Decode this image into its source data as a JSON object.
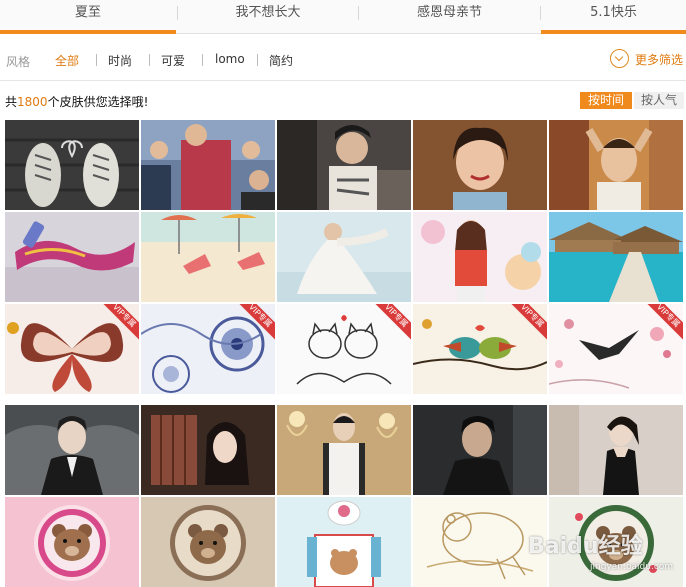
{
  "tabs": [
    {
      "label": "夏至",
      "active": true
    },
    {
      "label": "我不想长大",
      "active": false
    },
    {
      "label": "感恩母亲节",
      "active": false
    },
    {
      "label": "5.1快乐",
      "active": true
    }
  ],
  "filters": {
    "label": "风格",
    "items": [
      {
        "label": "全部",
        "active": true
      },
      {
        "label": "时尚",
        "active": false
      },
      {
        "label": "可爱",
        "active": false
      },
      {
        "label": "lomo",
        "active": false
      },
      {
        "label": "简约",
        "active": false
      }
    ],
    "more_label": "更多筛选"
  },
  "summary": {
    "prefix": "共",
    "count": "1800",
    "suffix": "个皮肤供您选择哦!"
  },
  "sort": {
    "by_time": "按时间",
    "by_popularity": "按人气"
  },
  "vip_badge": "VIP专属",
  "watermark": {
    "brand": "Baidu经验",
    "url": "jingyan.baidu.com"
  },
  "colors": {
    "accent": "#f08a1d",
    "accent_text": "#e07a10",
    "vip": "#d93a3a"
  },
  "tiles": [
    {
      "name": "sneakers-heart",
      "vip": false
    },
    {
      "name": "men-red-room",
      "vip": false
    },
    {
      "name": "young-man-graphic",
      "vip": false
    },
    {
      "name": "woman-smiling",
      "vip": false
    },
    {
      "name": "man-hands-on-head",
      "vip": false
    },
    {
      "name": "beach-scarf",
      "vip": false
    },
    {
      "name": "beach-chairs",
      "vip": false
    },
    {
      "name": "woman-white-dress",
      "vip": false
    },
    {
      "name": "girl-red-shirt",
      "vip": false
    },
    {
      "name": "resort-pier",
      "vip": false
    },
    {
      "name": "butterfly-art",
      "vip": true
    },
    {
      "name": "floral-pattern",
      "vip": true
    },
    {
      "name": "cat-sketch",
      "vip": true
    },
    {
      "name": "birds-branch",
      "vip": true
    },
    {
      "name": "bird-flowers",
      "vip": true
    },
    {
      "name": "man-black-coat",
      "vip": false
    },
    {
      "name": "woman-window",
      "vip": false
    },
    {
      "name": "man-chandelier",
      "vip": false
    },
    {
      "name": "man-dark",
      "vip": false
    },
    {
      "name": "woman-black-dress",
      "vip": false
    },
    {
      "name": "teddy-pink",
      "vip": false
    },
    {
      "name": "teddy-lace",
      "vip": false
    },
    {
      "name": "bear-window",
      "vip": false
    },
    {
      "name": "pooh-sketch",
      "vip": false
    },
    {
      "name": "teddy-wreath",
      "vip": false
    }
  ]
}
